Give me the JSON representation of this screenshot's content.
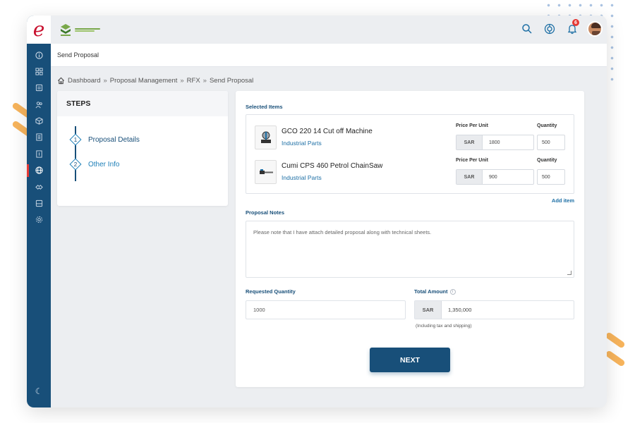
{
  "app": {
    "logo_letter": "e",
    "page_header": "Send Proposal",
    "notification_count": "6",
    "top_icons": [
      "search-icon",
      "globe-icon",
      "bell-icon"
    ],
    "sidebar_icons": [
      "info-icon",
      "grid-icon",
      "inbox-icon",
      "users-icon",
      "box-icon",
      "document-icon",
      "file-icon",
      "globe-icon",
      "handshake-icon",
      "archive-icon",
      "settings-icon",
      "moon-icon"
    ]
  },
  "breadcrumb": {
    "items": [
      "Dashboard",
      "Proposal Management",
      "RFX",
      "Send Proposal"
    ],
    "separator": "»"
  },
  "steps": {
    "title": "STEPS",
    "items": [
      {
        "number": "1",
        "label": "Proposal Details"
      },
      {
        "number": "2",
        "label": "Other Info"
      }
    ]
  },
  "form": {
    "selected_items_label": "Selected Items",
    "items": [
      {
        "name": "GCO 220 14 Cut off Machine",
        "category": "Industrial Parts",
        "price_label": "Price Per Unit",
        "quantity_label": "Quantity",
        "currency": "SAR",
        "price": "1800",
        "quantity": "500"
      },
      {
        "name": "Cumi CPS 460 Petrol ChainSaw",
        "category": "Industrial Parts",
        "price_label": "Price Per Unit",
        "quantity_label": "Quantity",
        "currency": "SAR",
        "price": "900",
        "quantity": "500"
      }
    ],
    "add_item": "Add item",
    "notes_label": "Proposal Notes",
    "notes_value": "Please note that I have attach detailed proposal along with technical sheets.",
    "requested_quantity_label": "Requested Quantity",
    "requested_quantity_value": "1000",
    "total_amount_label": "Total Amount",
    "total_currency": "SAR",
    "total_amount_value": "1,350,000",
    "tax_note": "(Including tax and shipping)",
    "next_label": "NEXT"
  },
  "colors": {
    "primary": "#184f79",
    "link": "#1d6fa5",
    "accent_orange": "#f7b45c",
    "badge_red": "#e53935"
  }
}
